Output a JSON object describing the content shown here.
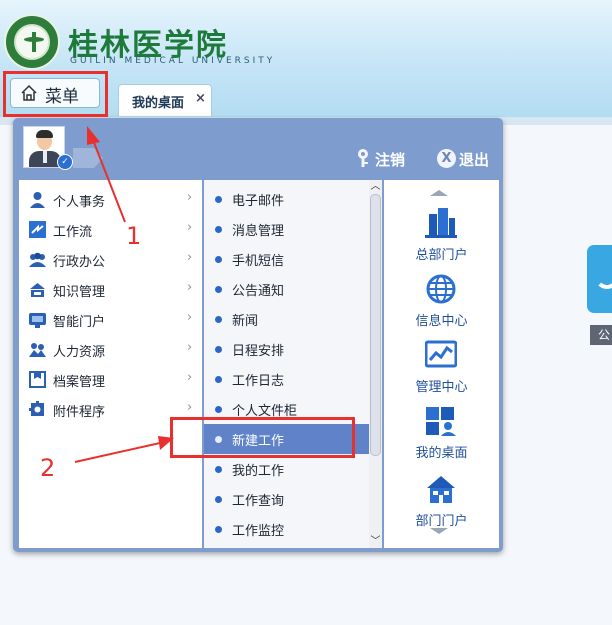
{
  "header": {
    "university_name": "桂林医学院",
    "university_name_en": "GUILIN MEDICAL UNIVERSITY",
    "menu_label": "菜单",
    "active_tab": "我的桌面",
    "tab_close": "×"
  },
  "panel": {
    "logout_label": "注销",
    "exit_label": "退出",
    "exit_icon_glyph": "X",
    "categories": [
      {
        "label": "个人事务",
        "icon": "person-icon"
      },
      {
        "label": "工作流",
        "icon": "workflow-icon"
      },
      {
        "label": "行政办公",
        "icon": "group-icon"
      },
      {
        "label": "知识管理",
        "icon": "knowledge-icon"
      },
      {
        "label": "智能门户",
        "icon": "portal-icon"
      },
      {
        "label": "人力资源",
        "icon": "hr-icon"
      },
      {
        "label": "档案管理",
        "icon": "archive-icon"
      },
      {
        "label": "附件程序",
        "icon": "attachment-icon"
      }
    ],
    "submenu": [
      {
        "label": "电子邮件"
      },
      {
        "label": "消息管理"
      },
      {
        "label": "手机短信"
      },
      {
        "label": "公告通知"
      },
      {
        "label": "新闻"
      },
      {
        "label": "日程安排"
      },
      {
        "label": "工作日志"
      },
      {
        "label": "个人文件柜"
      },
      {
        "label": "新建工作",
        "active": true
      },
      {
        "label": "我的工作"
      },
      {
        "label": "工作查询"
      },
      {
        "label": "工作监控"
      }
    ],
    "shortcuts": [
      {
        "label": "总部门户",
        "icon": "building-icon"
      },
      {
        "label": "信息中心",
        "icon": "globe-icon"
      },
      {
        "label": "管理中心",
        "icon": "chart-icon"
      },
      {
        "label": "我的桌面",
        "icon": "desktop-icon"
      },
      {
        "label": "部门门户",
        "icon": "house-icon"
      }
    ]
  },
  "side_widget": {
    "label": "公"
  },
  "annotations": {
    "label_1": "1",
    "label_2": "2"
  },
  "colors": {
    "annotation_red": "#e8312f",
    "panel_blue": "#7e9ccd",
    "active_item": "#5f82c8",
    "logo_green": "#1d7a3a"
  }
}
